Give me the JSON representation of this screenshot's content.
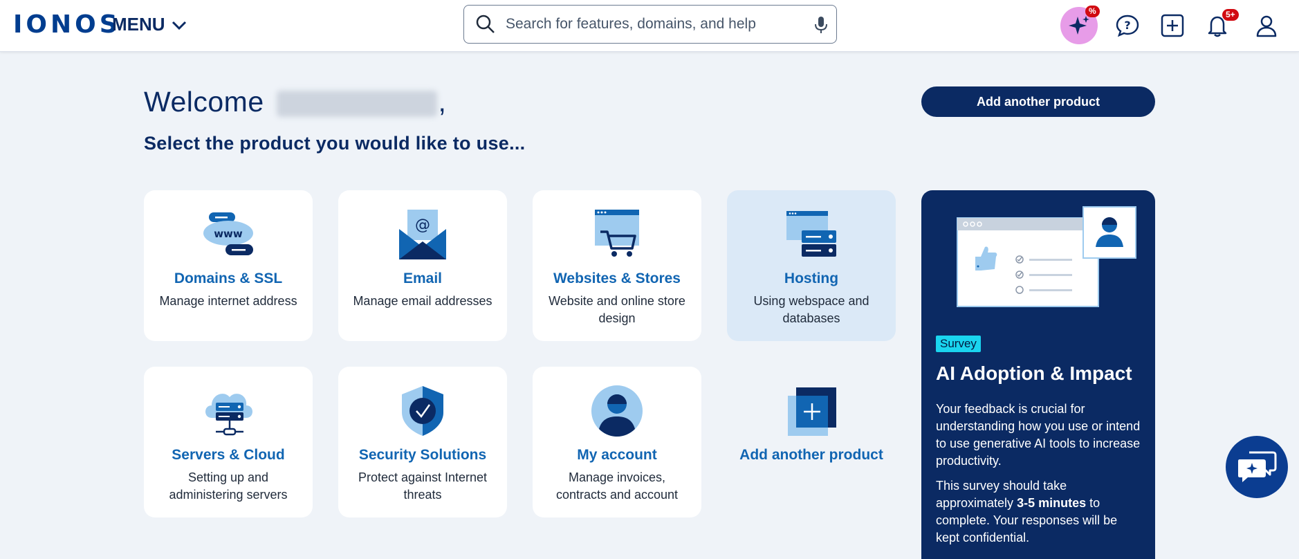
{
  "header": {
    "logo": "IONOS",
    "menu_label": "MENU",
    "search_placeholder": "Search for features, domains, and help",
    "ai_badge": "%",
    "notifications_badge": "5+"
  },
  "welcome": {
    "greeting": "Welcome",
    "name_hidden": "",
    "comma": ",",
    "subtitle": "Select the product you would like to use..."
  },
  "add_product_button": "Add another product",
  "products": [
    {
      "title": "Domains & SSL",
      "desc": "Manage internet address",
      "icon": "www-icon"
    },
    {
      "title": "Email",
      "desc": "Manage email addresses",
      "icon": "email-icon"
    },
    {
      "title": "Websites & Stores",
      "desc": "Website and online store design",
      "icon": "cart-icon"
    },
    {
      "title": "Hosting",
      "desc": "Using webspace and databases",
      "icon": "server-icon"
    },
    {
      "title": "Servers & Cloud",
      "desc": "Setting up and administering servers",
      "icon": "cloud-server-icon"
    },
    {
      "title": "Security Solutions",
      "desc": "Protect against Internet threats",
      "icon": "shield-icon"
    },
    {
      "title": "My account",
      "desc": "Manage invoices, contracts and account",
      "icon": "user-icon"
    },
    {
      "title": "Add another product",
      "desc": "",
      "icon": "add-icon"
    }
  ],
  "survey": {
    "tag": "Survey",
    "title": "AI Adoption & Impact",
    "p1": "Your feedback is crucial for understanding how you use or intend to use generative AI tools to increase productivity.",
    "p2_a": "This survey should take approximately ",
    "p2_b": "3-5 minutes",
    "p2_c": " to complete. Your responses will be kept confidential."
  },
  "colors": {
    "brand": "#003d8f",
    "navy": "#0b2a63",
    "link": "#1165b2",
    "background": "#eff3f8",
    "active_card": "#dbe9f7",
    "survey_tag": "#1ad5ef"
  }
}
